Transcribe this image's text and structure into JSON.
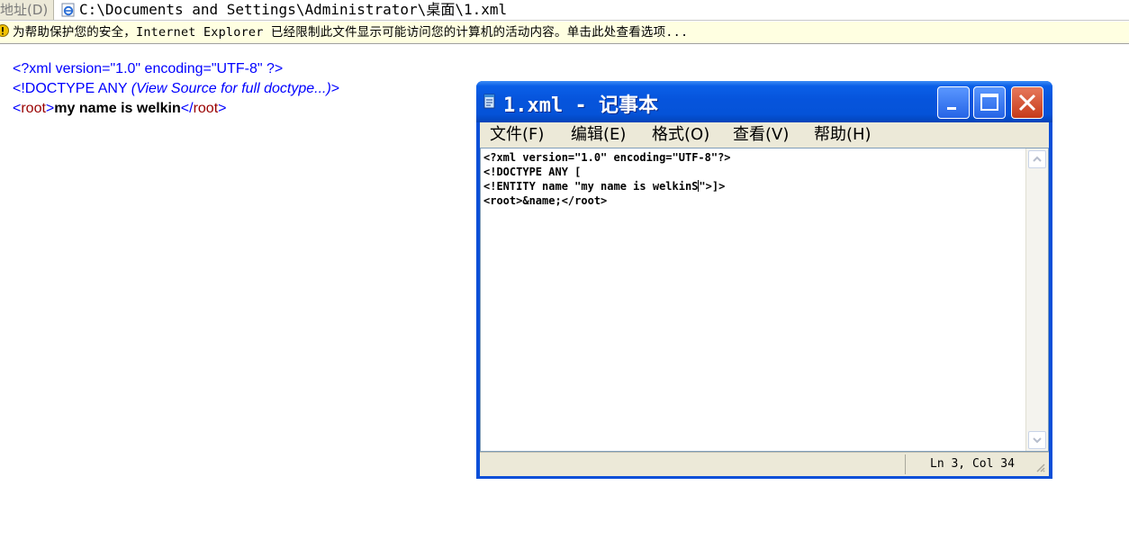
{
  "addressbar": {
    "label": "地址(D)",
    "path": "C:\\Documents and Settings\\Administrator\\桌面\\1.xml"
  },
  "infobar": {
    "text": "为帮助保护您的安全，Internet Explorer 已经限制此文件显示可能访问您的计算机的活动内容。单击此处查看选项..."
  },
  "xml_view": {
    "decl": "<?xml version=\"1.0\" encoding=\"UTF-8\" ?>",
    "doctype": "<!DOCTYPE ANY",
    "doctype_note": "(View Source for full doctype...)",
    "doctype_close": ">",
    "root_open": "<",
    "root_tag": "root",
    "root_close_bracket": ">",
    "root_content": "my name is welkin",
    "root_end_open": "</",
    "root_end_tag": "root",
    "root_end_close": ">"
  },
  "notepad": {
    "title": "1.xml - 记事本",
    "menu": [
      "文件(F)",
      "编辑(E)",
      "格式(O)",
      "查看(V)",
      "帮助(H)"
    ],
    "lines": [
      "<?xml version=\"1.0\" encoding=\"UTF-8\"?>",
      "<!DOCTYPE ANY [",
      "<!ENTITY name \"my name is welkinS",
      "\">]>",
      "<root>&name;</root>"
    ],
    "status": "Ln 3, Col 34"
  },
  "colors": {
    "title_blue": "#0553d8",
    "menu_bg": "#ece9d8",
    "xml_blue": "#0000ff",
    "xml_tag_red": "#990000",
    "close_red": "#c63a1a"
  }
}
